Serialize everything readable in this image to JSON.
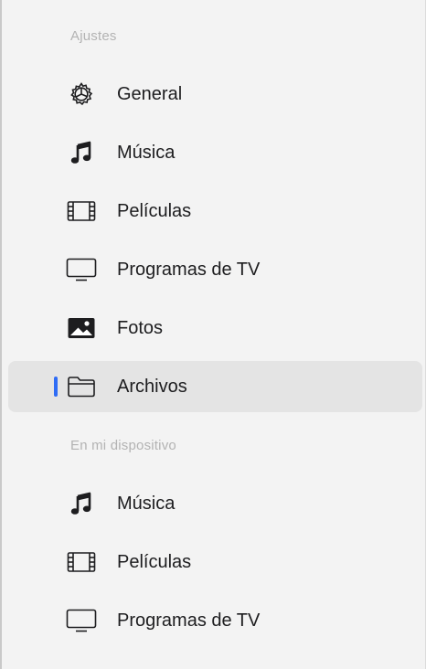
{
  "sidebar": {
    "sections": [
      {
        "header": "Ajustes",
        "items": [
          {
            "label": "General",
            "icon": "gear-icon",
            "selected": false
          },
          {
            "label": "Música",
            "icon": "music-note-icon",
            "selected": false
          },
          {
            "label": "Películas",
            "icon": "film-icon",
            "selected": false
          },
          {
            "label": "Programas de TV",
            "icon": "tv-icon",
            "selected": false
          },
          {
            "label": "Fotos",
            "icon": "photo-icon",
            "selected": false
          },
          {
            "label": "Archivos",
            "icon": "folder-icon",
            "selected": true
          }
        ]
      },
      {
        "header": "En mi dispositivo",
        "items": [
          {
            "label": "Música",
            "icon": "music-note-icon",
            "selected": false
          },
          {
            "label": "Películas",
            "icon": "film-icon",
            "selected": false
          },
          {
            "label": "Programas de TV",
            "icon": "tv-icon",
            "selected": false
          }
        ]
      }
    ]
  },
  "colors": {
    "accent": "#2f6cf5",
    "background": "#f3f3f3",
    "selected_row": "#e4e4e4",
    "section_header": "#b3b3b3",
    "text": "#1d1d1f"
  }
}
